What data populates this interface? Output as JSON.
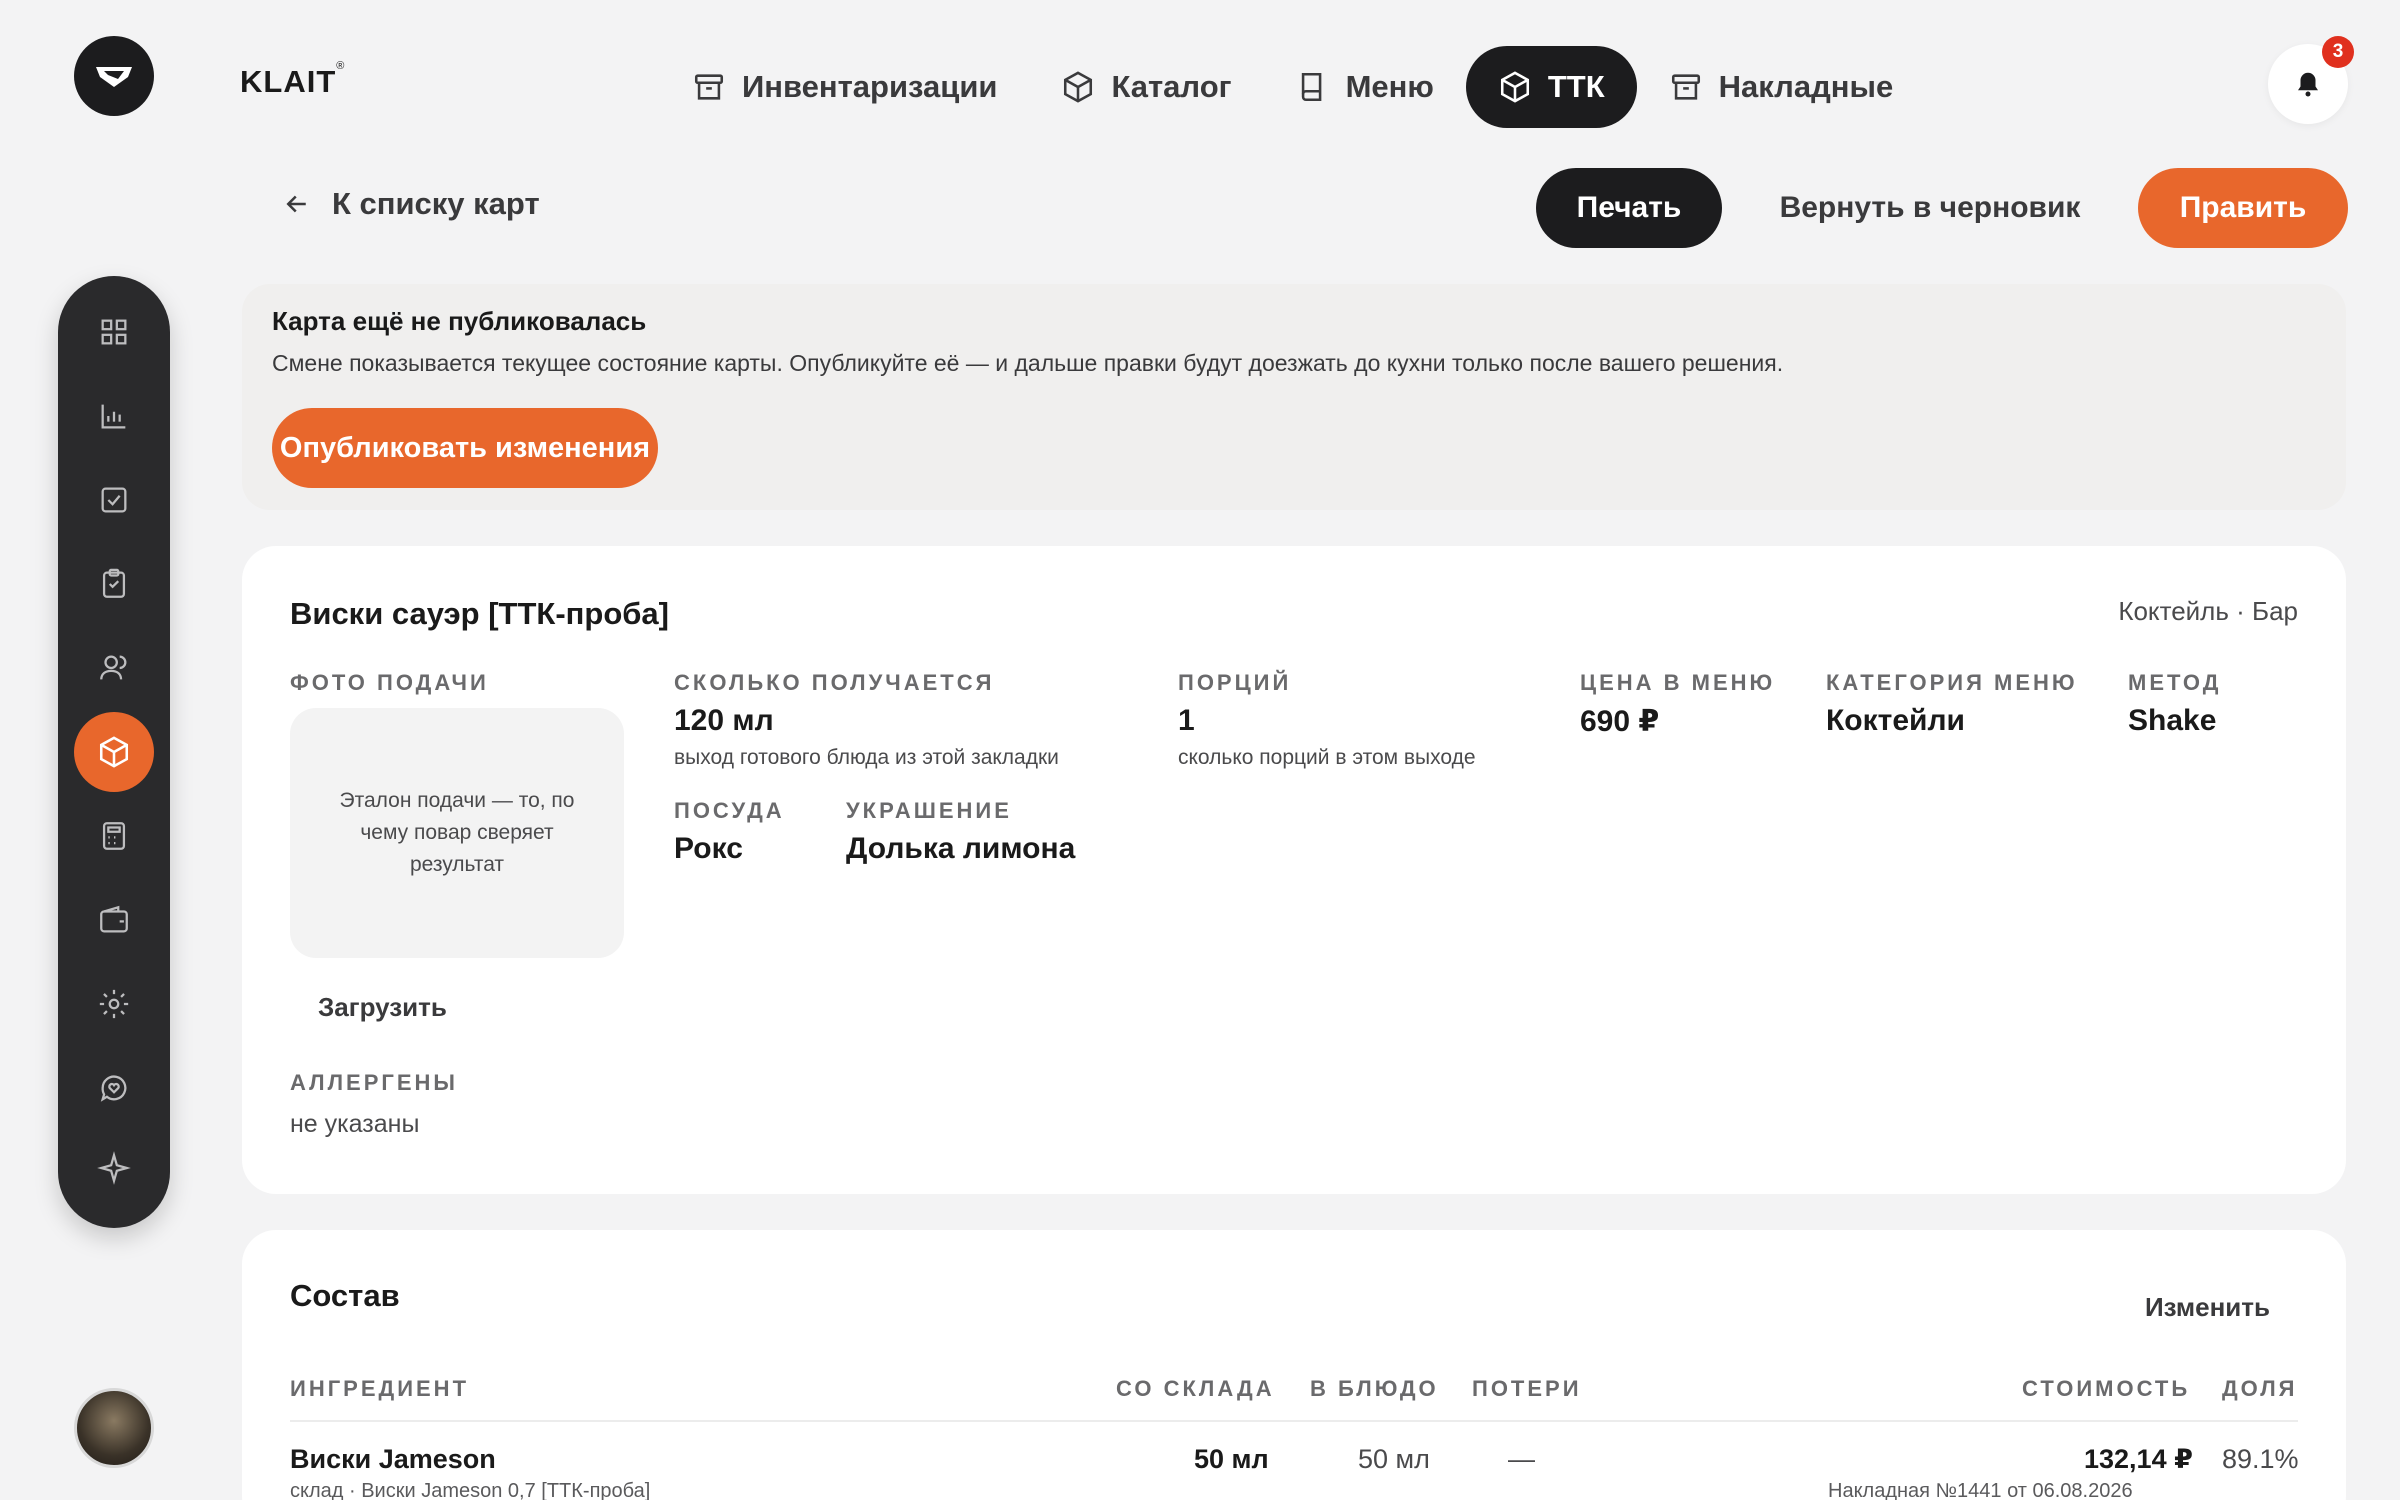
{
  "brand": {
    "name": "KLAIT",
    "mark": "®"
  },
  "topnav": {
    "items": [
      {
        "label": "Инвентаризации",
        "icon": "archive-icon",
        "active": false
      },
      {
        "label": "Каталог",
        "icon": "box-icon",
        "active": false
      },
      {
        "label": "Меню",
        "icon": "book-icon",
        "active": false
      },
      {
        "label": "ТТК",
        "icon": "box-icon",
        "active": true
      },
      {
        "label": "Накладные",
        "icon": "archive-icon",
        "active": false
      }
    ]
  },
  "notifications": {
    "count": "3"
  },
  "toolbar": {
    "back_label": "К списку карт",
    "print_label": "Печать",
    "draft_label": "Вернуть в черновик",
    "edit_label": "Править"
  },
  "notice": {
    "title": "Карта ещё не публиковалась",
    "text": "Смене показывается текущее состояние карты. Опубликуйте её — и дальше правки будут доезжать до кухни только после вашего решения.",
    "publish_label": "Опубликовать изменения"
  },
  "card": {
    "title": "Виски сауэр [ТТК-проба]",
    "tags": "Коктейль · Бар",
    "photo_label": "ФОТО ПОДАЧИ",
    "photo_placeholder": "Эталон подачи — то, по чему повар сверяет результат",
    "upload_label": "Загрузить",
    "allergens_label": "АЛЛЕРГЕНЫ",
    "allergens_value": "не указаны",
    "yield_label": "СКОЛЬКО ПОЛУЧАЕТСЯ",
    "yield_value": "120 мл",
    "yield_hint": "выход готового блюда из этой закладки",
    "portions_label": "ПОРЦИЙ",
    "portions_value": "1",
    "portions_hint": "сколько порций в этом выходе",
    "price_label": "ЦЕНА В МЕНЮ",
    "price_value": "690 ₽",
    "category_label": "КАТЕГОРИЯ МЕНЮ",
    "category_value": "Коктейли",
    "method_label": "МЕТОД",
    "method_value": "Shake",
    "glass_label": "ПОСУДА",
    "glass_value": "Рокс",
    "garnish_label": "УКРАШЕНИЕ",
    "garnish_value": "Долька лимона"
  },
  "composition": {
    "title": "Состав",
    "change_label": "Изменить",
    "headers": {
      "ingredient": "ИНГРЕДИЕНТ",
      "from_stock": "СО СКЛАДА",
      "in_dish": "В БЛЮДО",
      "losses": "ПОТЕРИ",
      "cost": "СТОИМОСТЬ",
      "share": "ДОЛЯ"
    },
    "rows": [
      {
        "ingredient": "Виски Jameson",
        "source": "склад · Виски Jameson 0,7 [ТТК-проба]",
        "from_stock": "50 мл",
        "in_dish": "50 мл",
        "losses": "—",
        "cost": "132,14 ₽",
        "invoice": "Накладная №1441 от 06.08.2026",
        "share": "89.1%"
      }
    ]
  },
  "colors": {
    "accent": "#e8672c",
    "dark": "#1c1c1e",
    "badge": "#e0301e"
  }
}
